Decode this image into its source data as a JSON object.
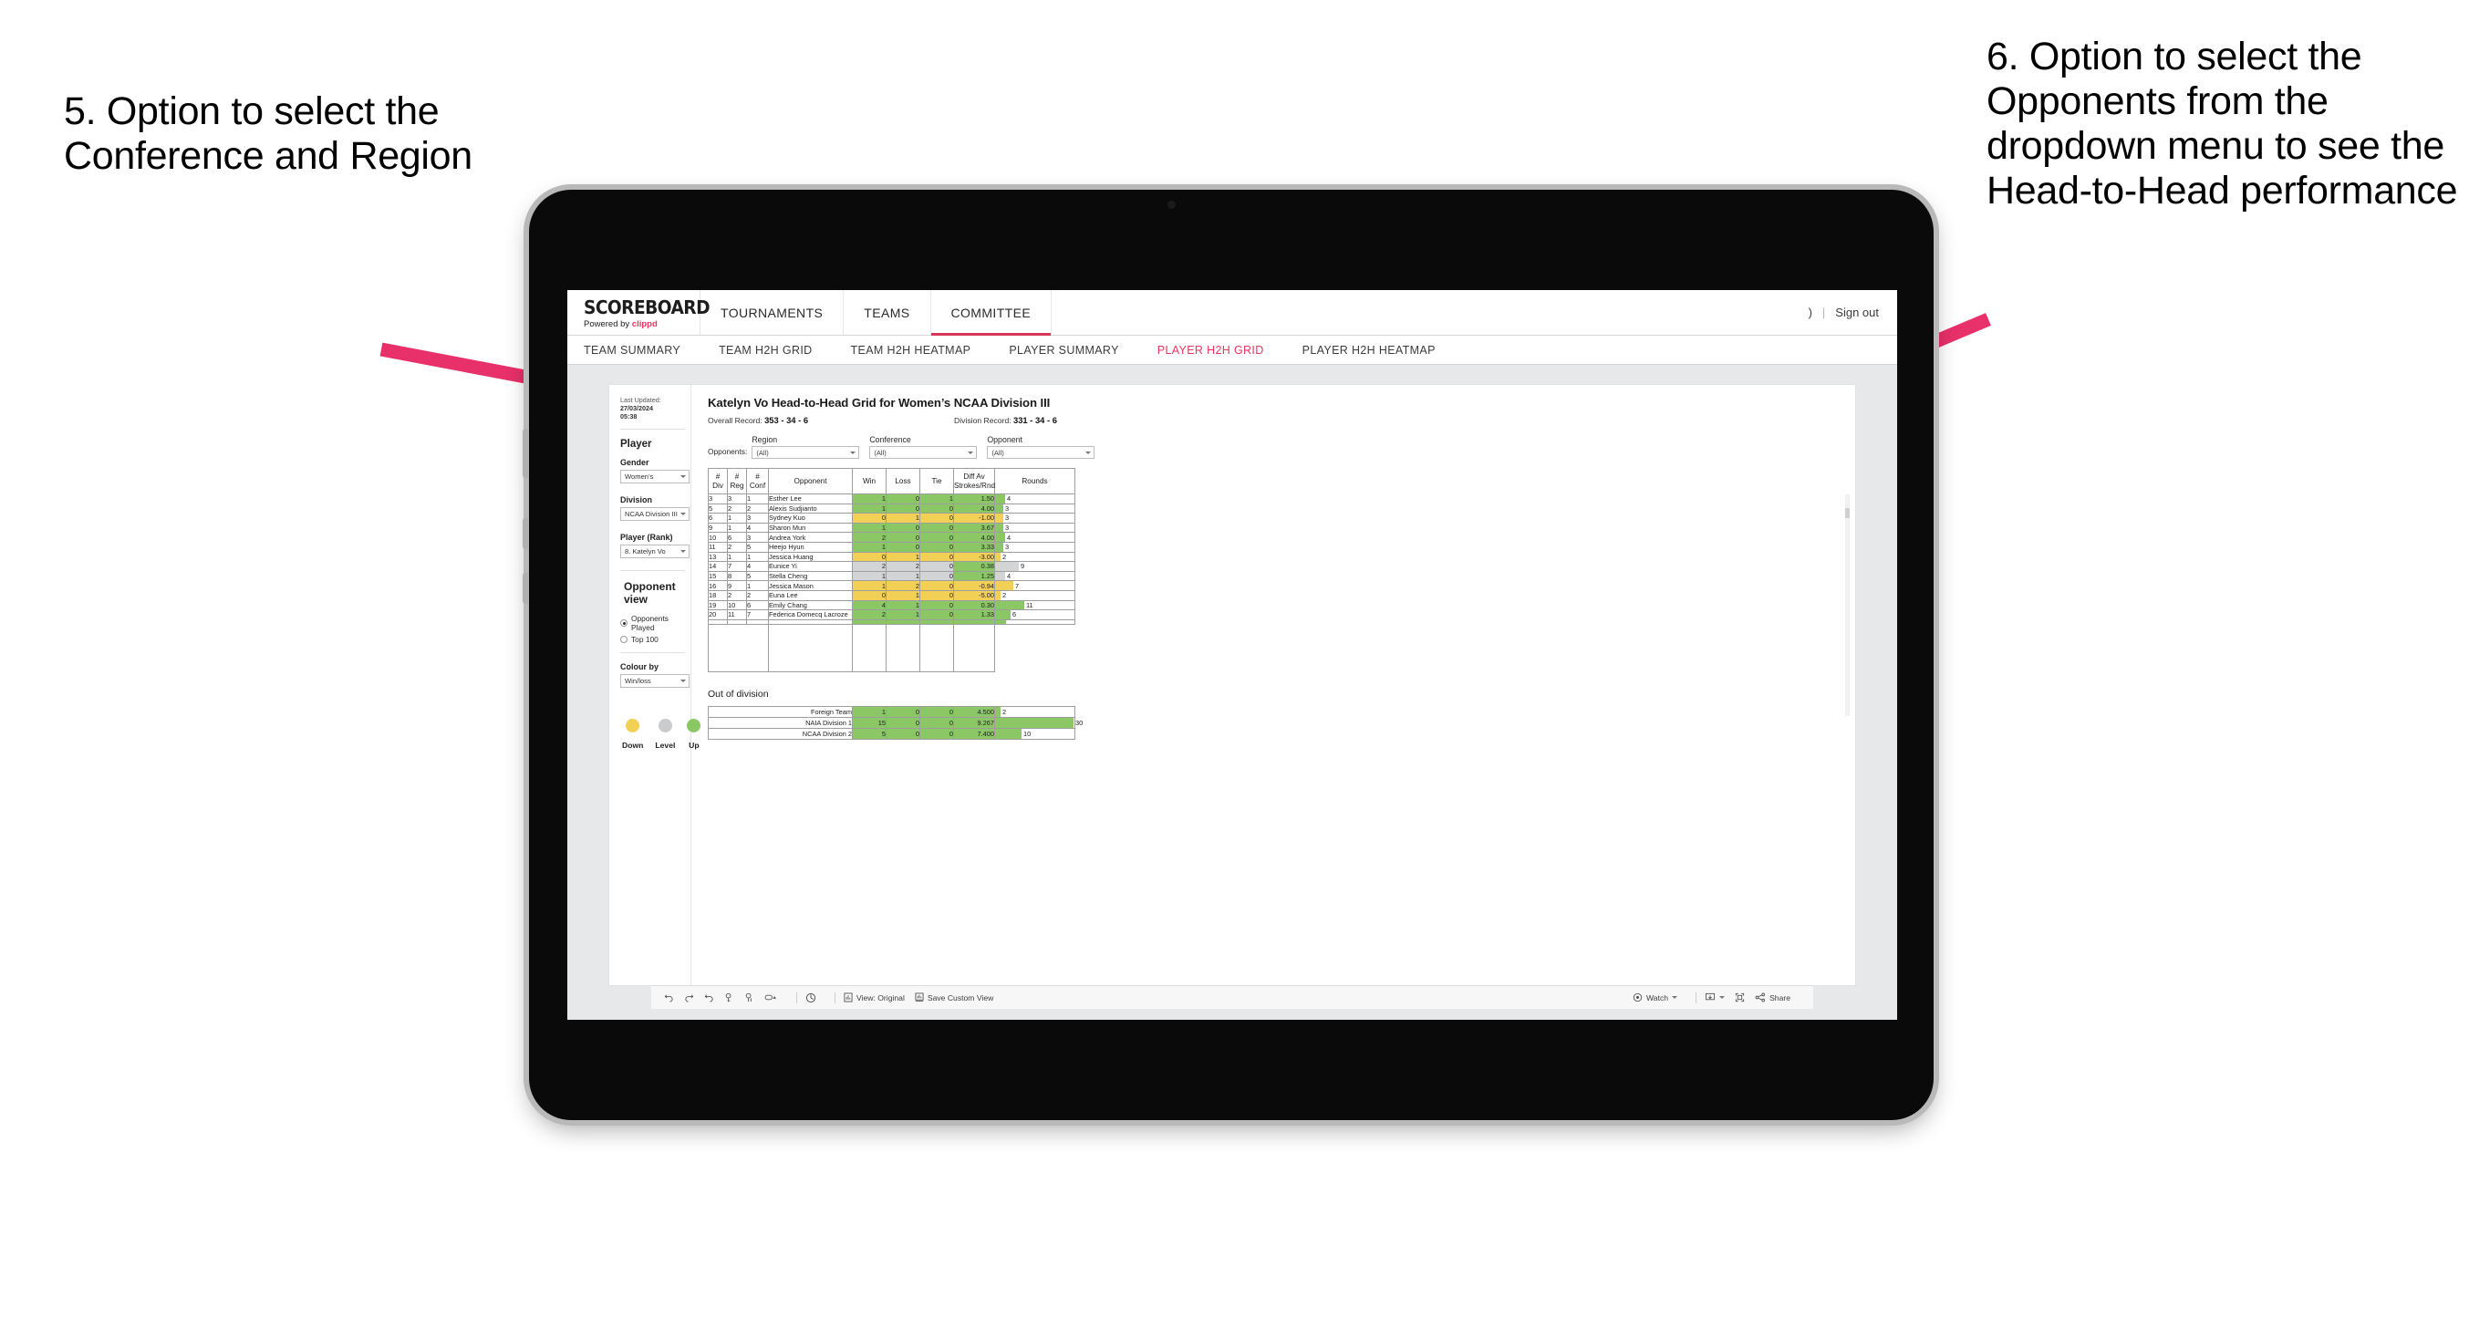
{
  "annotations": {
    "left": "5. Option to select the Conference and Region",
    "right": "6. Option to select the Opponents from the dropdown menu to see the Head-to-Head performance",
    "arrow_color": "#e8306a"
  },
  "app": {
    "brand_name": "SCOREBOARD",
    "brand_sub_prefix": "Powered by ",
    "brand_sub_accent": "clippd",
    "top_nav": [
      {
        "label": "TOURNAMENTS",
        "active": false
      },
      {
        "label": "TEAMS",
        "active": false
      },
      {
        "label": "COMMITTEE",
        "active": true
      }
    ],
    "account_glyph": ")",
    "account_sep": "|",
    "sign_out": "Sign out",
    "sub_nav": [
      {
        "label": "TEAM SUMMARY",
        "active": false
      },
      {
        "label": "TEAM H2H GRID",
        "active": false
      },
      {
        "label": "TEAM H2H HEATMAP",
        "active": false
      },
      {
        "label": "PLAYER SUMMARY",
        "active": false
      },
      {
        "label": "PLAYER H2H GRID",
        "active": true
      },
      {
        "label": "PLAYER H2H HEATMAP",
        "active": false
      }
    ],
    "accent_color": "#e8365d"
  },
  "sidebar": {
    "last_updated_label": "Last Updated: ",
    "last_updated_value": "27/03/2024",
    "last_updated_time": "05:38",
    "player_heading": "Player",
    "gender_label": "Gender",
    "gender_value": "Women’s",
    "division_label": "Division",
    "division_value": "NCAA Division III",
    "player_rank_label": "Player (Rank)",
    "player_rank_value": "8. Katelyn Vo",
    "opponent_view_heading": "Opponent view",
    "opponent_view_options": [
      {
        "label": "Opponents Played",
        "selected": true
      },
      {
        "label": "Top 100",
        "selected": false
      }
    ],
    "colour_by_label": "Colour by",
    "colour_by_value": "Win/loss",
    "legend": [
      {
        "label": "Down",
        "color": "#f2d055"
      },
      {
        "label": "Level",
        "color": "#c9cbcd"
      },
      {
        "label": "Up",
        "color": "#8bc765"
      }
    ]
  },
  "main": {
    "title": "Katelyn Vo Head-to-Head Grid for Women’s NCAA Division III",
    "overall_record_label": "Overall Record: ",
    "overall_record_value": "353 - 34 - 6",
    "division_record_label": "Division Record: ",
    "division_record_value": "331 - 34 - 6",
    "opponents_label": "Opponents:",
    "filters": [
      {
        "label": "Region",
        "value": "(All)"
      },
      {
        "label": "Conference",
        "value": "(All)"
      },
      {
        "label": "Opponent",
        "value": "(All)"
      }
    ],
    "out_of_division_title": "Out of division"
  },
  "chart_data": {
    "type": "table",
    "title": "Katelyn Vo Head-to-Head Grid for Women’s NCAA Division III",
    "columns": [
      "# Div",
      "# Reg",
      "# Conf",
      "Opponent",
      "Win",
      "Loss",
      "Tie",
      "Diff Av Strokes/Rnd",
      "Rounds"
    ],
    "column_header_lines": [
      [
        "#",
        "Div"
      ],
      [
        "#",
        "Reg"
      ],
      [
        "#",
        "Conf"
      ],
      [
        "Opponent",
        ""
      ],
      [
        "Win",
        ""
      ],
      [
        "Loss",
        ""
      ],
      [
        "Tie",
        ""
      ],
      [
        "Diff Av",
        "Strokes/Rnd"
      ],
      [
        "Rounds",
        ""
      ]
    ],
    "rounds_max": 30,
    "colors": {
      "up": "#8bc765",
      "down": "#f2d055",
      "level": "#d2d4d6",
      "empty": "#ffffff"
    },
    "rows": [
      {
        "div": "3",
        "reg": "3",
        "conf": "1",
        "opponent": "Esther Lee",
        "win": "1",
        "loss": "0",
        "tie": "1",
        "diff": "1.50",
        "rounds": "4",
        "rounds_n": 4,
        "state": "up"
      },
      {
        "div": "5",
        "reg": "2",
        "conf": "2",
        "opponent": "Alexis Sudjianto",
        "win": "1",
        "loss": "0",
        "tie": "0",
        "diff": "4.00",
        "rounds": "3",
        "rounds_n": 3,
        "state": "up"
      },
      {
        "div": "6",
        "reg": "1",
        "conf": "3",
        "opponent": "Sydney Kuo",
        "win": "0",
        "loss": "1",
        "tie": "0",
        "diff": "-1.00",
        "rounds": "3",
        "rounds_n": 3,
        "state": "down"
      },
      {
        "div": "9",
        "reg": "1",
        "conf": "4",
        "opponent": "Sharon Mun",
        "win": "1",
        "loss": "0",
        "tie": "0",
        "diff": "3.67",
        "rounds": "3",
        "rounds_n": 3,
        "state": "up"
      },
      {
        "div": "10",
        "reg": "6",
        "conf": "3",
        "opponent": "Andrea York",
        "win": "2",
        "loss": "0",
        "tie": "0",
        "diff": "4.00",
        "rounds": "4",
        "rounds_n": 4,
        "state": "up"
      },
      {
        "div": "11",
        "reg": "2",
        "conf": "5",
        "opponent": "Heejo Hyun",
        "win": "1",
        "loss": "0",
        "tie": "0",
        "diff": "3.33",
        "rounds": "3",
        "rounds_n": 3,
        "state": "up"
      },
      {
        "div": "13",
        "reg": "1",
        "conf": "1",
        "opponent": "Jessica Huang",
        "win": "0",
        "loss": "1",
        "tie": "0",
        "diff": "-3.00",
        "rounds": "2",
        "rounds_n": 2,
        "state": "down"
      },
      {
        "div": "14",
        "reg": "7",
        "conf": "4",
        "opponent": "Eunice Yi",
        "win": "2",
        "loss": "2",
        "tie": "0",
        "diff": "0.38",
        "rounds": "9",
        "rounds_n": 9,
        "state": "level",
        "diff_state": "up"
      },
      {
        "div": "15",
        "reg": "8",
        "conf": "5",
        "opponent": "Stella Cheng",
        "win": "1",
        "loss": "1",
        "tie": "0",
        "diff": "1.25",
        "rounds": "4",
        "rounds_n": 4,
        "state": "level",
        "diff_state": "up"
      },
      {
        "div": "16",
        "reg": "9",
        "conf": "1",
        "opponent": "Jessica Mason",
        "win": "1",
        "loss": "2",
        "tie": "0",
        "diff": "-0.94",
        "rounds": "7",
        "rounds_n": 7,
        "state": "down"
      },
      {
        "div": "18",
        "reg": "2",
        "conf": "2",
        "opponent": "Euna Lee",
        "win": "0",
        "loss": "1",
        "tie": "0",
        "diff": "-5.00",
        "rounds": "2",
        "rounds_n": 2,
        "state": "down"
      },
      {
        "div": "19",
        "reg": "10",
        "conf": "6",
        "opponent": "Emily Chang",
        "win": "4",
        "loss": "1",
        "tie": "0",
        "diff": "0.30",
        "rounds": "11",
        "rounds_n": 11,
        "state": "up"
      },
      {
        "div": "20",
        "reg": "11",
        "conf": "7",
        "opponent": "Federica Domecq Lacroze",
        "win": "2",
        "loss": "1",
        "tie": "0",
        "diff": "1.33",
        "rounds": "6",
        "rounds_n": 6,
        "state": "up"
      }
    ],
    "out_of_division": {
      "rounds_max": 30,
      "rows": [
        {
          "name": "Foreign Team",
          "win": "1",
          "loss": "0",
          "tie": "0",
          "diff": "4.500",
          "rounds": "2",
          "rounds_n": 2,
          "state": "up"
        },
        {
          "name": "NAIA Division 1",
          "win": "15",
          "loss": "0",
          "tie": "0",
          "diff": "9.267",
          "rounds": "30",
          "rounds_n": 30,
          "state": "up"
        },
        {
          "name": "NCAA Division 2",
          "win": "5",
          "loss": "0",
          "tie": "0",
          "diff": "7.400",
          "rounds": "10",
          "rounds_n": 10,
          "state": "up"
        }
      ]
    }
  },
  "toolbar": {
    "view_label": "View: Original",
    "save_label": "Save Custom View",
    "watch_label": "Watch",
    "share_label": "Share"
  }
}
